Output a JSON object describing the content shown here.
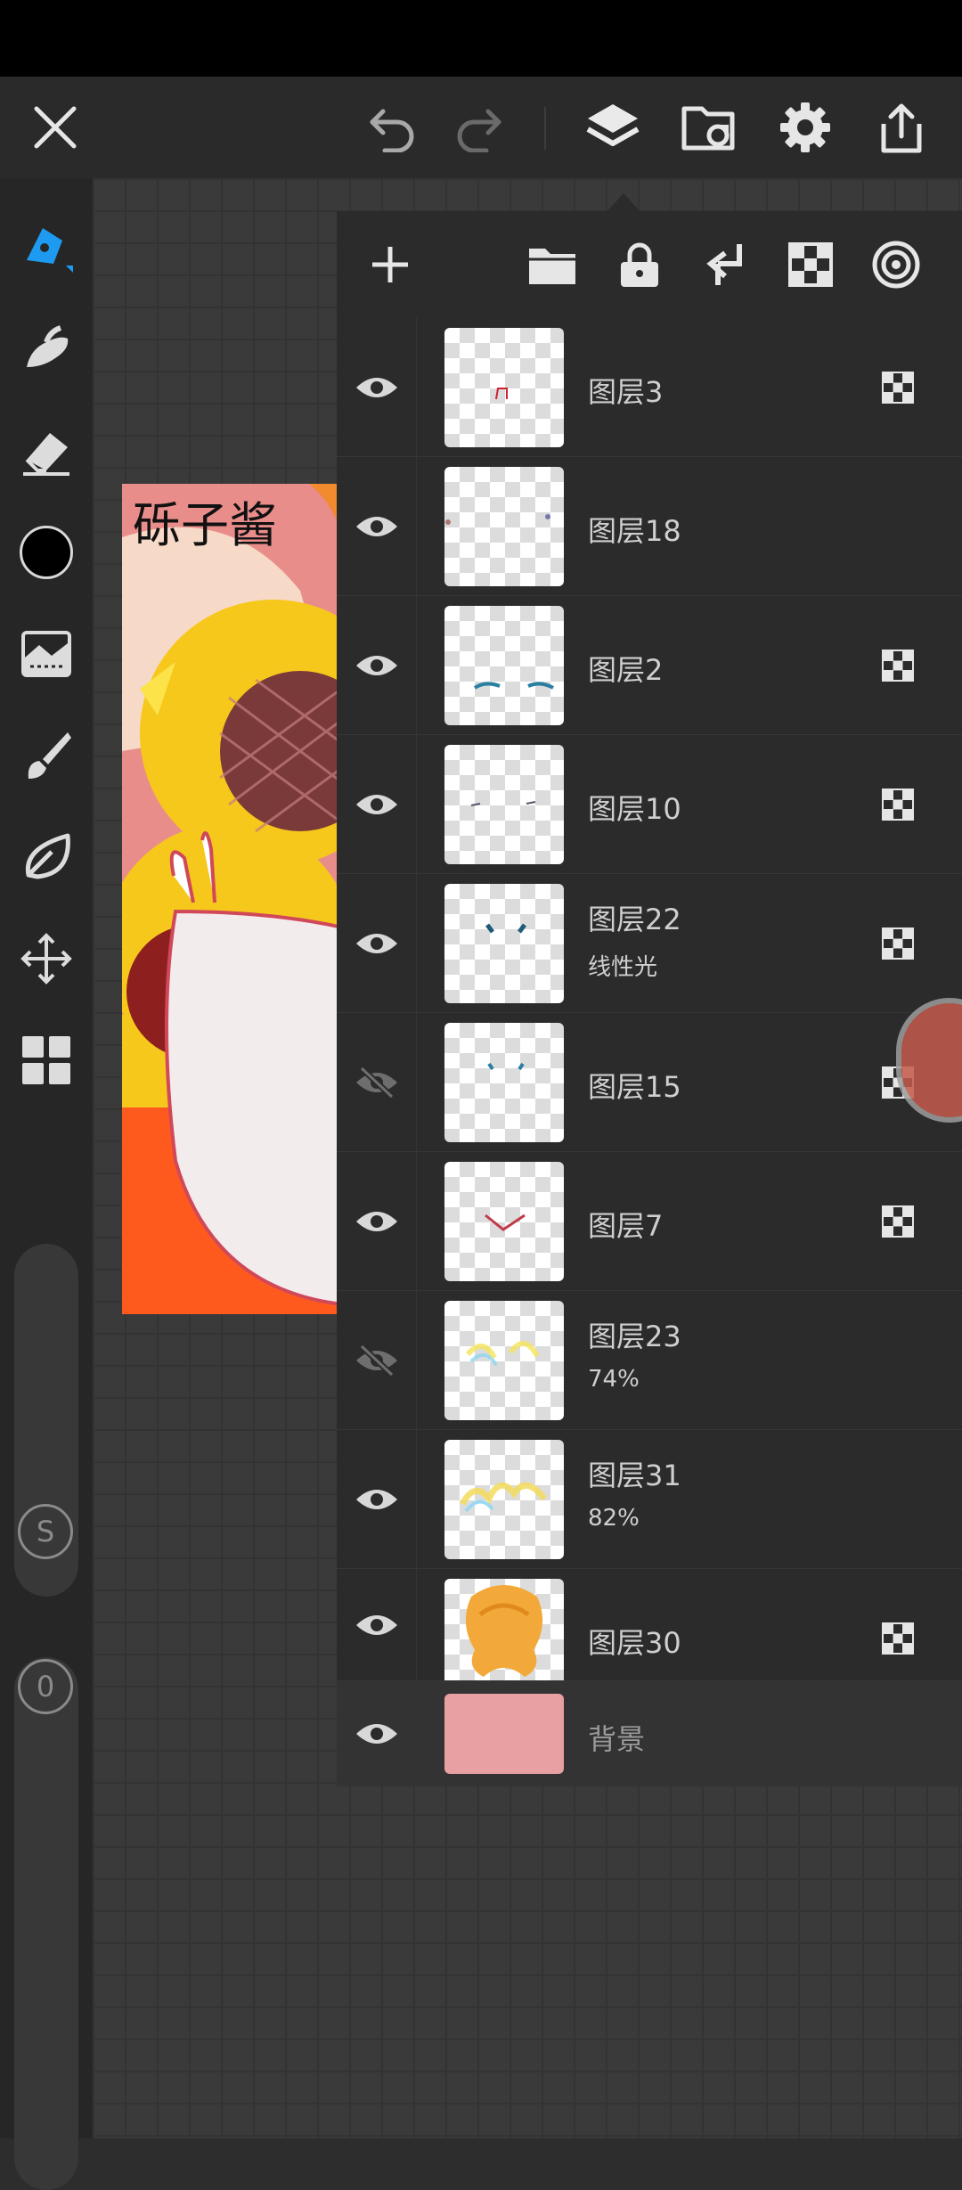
{
  "app": {
    "accent_color": "#1e9bf0",
    "top_bar_icons": [
      "close-icon",
      "undo-icon",
      "redo-icon",
      "layers-icon",
      "import-icon",
      "settings-icon",
      "export-icon"
    ]
  },
  "left_toolbar": {
    "tools": [
      "pen-icon",
      "smudge-icon",
      "eraser-icon",
      "color-swatch",
      "image-adjust-icon",
      "brush-icon",
      "leaf-icon",
      "move-icon",
      "grid-icon"
    ],
    "current_color": "#000000",
    "size_badge": "S",
    "opacity_badge": "0"
  },
  "canvas": {
    "artwork_text": "砾子酱"
  },
  "layers_panel": {
    "toolbar_icons": [
      "add-layer-icon",
      "folder-icon",
      "lock-icon",
      "merge-down-icon",
      "alpha-lock-icon",
      "blend-icon"
    ],
    "layers": [
      {
        "name": "图层3",
        "sub": "",
        "visible": true,
        "alpha_lock": true
      },
      {
        "name": "图层18",
        "sub": "",
        "visible": true,
        "alpha_lock": false
      },
      {
        "name": "图层2",
        "sub": "",
        "visible": true,
        "alpha_lock": true
      },
      {
        "name": "图层10",
        "sub": "",
        "visible": true,
        "alpha_lock": true
      },
      {
        "name": "图层22",
        "sub": "线性光",
        "visible": true,
        "alpha_lock": true
      },
      {
        "name": "图层15",
        "sub": "",
        "visible": false,
        "alpha_lock": true
      },
      {
        "name": "图层7",
        "sub": "",
        "visible": true,
        "alpha_lock": true
      },
      {
        "name": "图层23",
        "sub": "74%",
        "visible": false,
        "alpha_lock": false
      },
      {
        "name": "图层31",
        "sub": "82%",
        "visible": true,
        "alpha_lock": false
      },
      {
        "name": "图层30",
        "sub": "",
        "visible": true,
        "alpha_lock": true
      }
    ],
    "background": {
      "name": "背景",
      "color": "#e8a0a2",
      "visible": true
    }
  }
}
